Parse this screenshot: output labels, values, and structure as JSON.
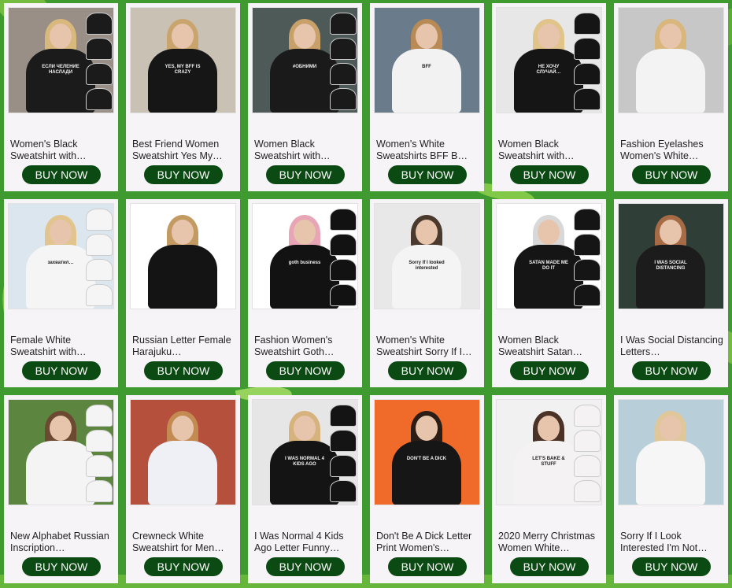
{
  "colors": {
    "button_bg": "#0b4a12",
    "button_text": "#ffffff",
    "card_bg": "#f6f4f7",
    "page_bg": "#3f9a2f"
  },
  "button_label": "BUY NOW",
  "products": [
    {
      "title": "Women's Black Sweatshirt with…",
      "image_icon": "sweatshirt-photo-icon",
      "shirt": "#1b1b1b",
      "print": "ЕСЛИ ЧЕЛЕНИЕ НАСЛАДИ"
    },
    {
      "title": "Best Friend Women Sweatshirt Yes My…",
      "image_icon": "sweatshirt-photo-icon",
      "shirt": "#161616",
      "print": "YES, MY BFF IS CRAZY"
    },
    {
      "title": "Women Black Sweatshirt with…",
      "image_icon": "sweatshirt-photo-icon",
      "shirt": "#1a1a1a",
      "print": "#ОБНИМИ"
    },
    {
      "title": "Women's White Sweatshirts BFF B…",
      "image_icon": "sweatshirt-photo-icon",
      "shirt": "#f2f2f2",
      "print": "BFF"
    },
    {
      "title": "Women Black Sweatshirt with…",
      "image_icon": "sweatshirt-photo-icon",
      "shirt": "#151515",
      "print": "НЕ ХОЧУ СЛУЧАЙ…"
    },
    {
      "title": "Fashion Eyelashes Women's White…",
      "image_icon": "sweatshirt-photo-icon",
      "shirt": "#f3f3f3",
      "print": ""
    },
    {
      "title": "Female White Sweatshirt with…",
      "image_icon": "sweatshirt-photo-icon",
      "shirt": "#f5f5f5",
      "print": "захватил…"
    },
    {
      "title": "Russian Letter Female Harajuku…",
      "image_icon": "sweatshirt-photo-icon",
      "shirt": "#141414",
      "print": ""
    },
    {
      "title": "Fashion Women's Sweatshirt Goth…",
      "image_icon": "sweatshirt-photo-icon",
      "shirt": "#121212",
      "print": "goth business"
    },
    {
      "title": "Women's White Sweatshirt Sorry If I…",
      "image_icon": "sweatshirt-photo-icon",
      "shirt": "#f4f4f4",
      "print": "Sorry If I looked interested"
    },
    {
      "title": "Women Black Sweatshirt Satan…",
      "image_icon": "sweatshirt-photo-icon",
      "shirt": "#151515",
      "print": "SATAN MADE ME DO IT"
    },
    {
      "title": "I Was Social Distancing Letters…",
      "image_icon": "sweatshirt-photo-icon",
      "shirt": "#1c1c1c",
      "print": "I WAS SOCIAL DISTANCING"
    },
    {
      "title": "New Alphabet Russian Inscription…",
      "image_icon": "sweatshirt-photo-icon",
      "shirt": "#f4f4f4",
      "print": ""
    },
    {
      "title": "Crewneck White Sweatshirt for Men…",
      "image_icon": "sweatshirt-photo-icon",
      "shirt": "#eef0f6",
      "print": ""
    },
    {
      "title": "I Was Normal 4 Kids Ago Letter Funny…",
      "image_icon": "sweatshirt-photo-icon",
      "shirt": "#141414",
      "print": "I WAS NORMAL 4 KIDS AGO"
    },
    {
      "title": "Don't Be A Dick Letter Print Women's…",
      "image_icon": "sweatshirt-photo-icon",
      "shirt": "#161616",
      "print": "DON'T BE A DICK"
    },
    {
      "title": "2020 Merry Christmas Women White…",
      "image_icon": "sweatshirt-photo-icon",
      "shirt": "#f4f2f2",
      "print": "LET'S BAKE & STUFF"
    },
    {
      "title": "Sorry If I Look Interested I'm Not…",
      "image_icon": "sweatshirt-photo-icon",
      "shirt": "#f6f6f6",
      "print": ""
    }
  ]
}
